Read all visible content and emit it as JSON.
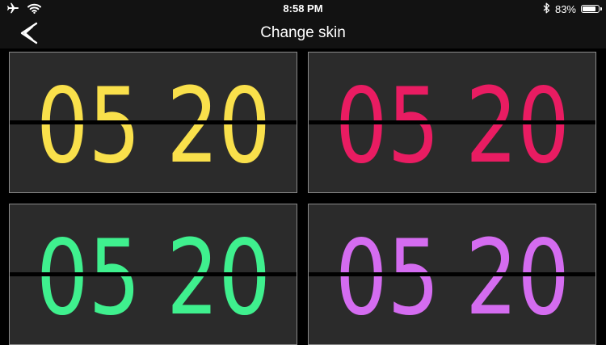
{
  "status": {
    "time": "8:58 PM",
    "battery": "83%",
    "battery_level": 0.83,
    "icons": [
      "airplane-icon",
      "wifi-icon",
      "bluetooth-icon",
      "battery-icon"
    ]
  },
  "nav": {
    "title": "Change skin",
    "back_icon": "chevron-left-icon"
  },
  "skins": [
    {
      "name": "yellow",
      "color": "#f9e04b",
      "time": "05 20"
    },
    {
      "name": "pink",
      "color": "#e91c62",
      "time": "05 20"
    },
    {
      "name": "green",
      "color": "#3ff08e",
      "time": "05 20"
    },
    {
      "name": "purple",
      "color": "#d46cf0",
      "time": "05 20"
    }
  ],
  "colors": {
    "background": "#000000",
    "bar": "#121212",
    "card": "#2b2b2b",
    "card_border": "#8a8a8a",
    "divider": "#000000"
  }
}
